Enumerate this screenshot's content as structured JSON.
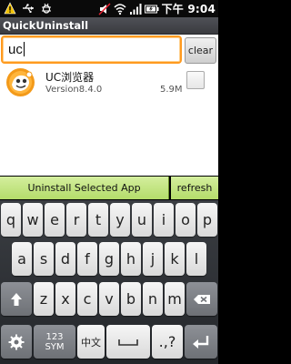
{
  "status_bar": {
    "time": "下午 9:04",
    "icons": [
      "warning-icon",
      "usb-icon",
      "usb-debug-icon",
      "mute-icon",
      "wifi-icon",
      "signal-icon",
      "battery-icon"
    ]
  },
  "app": {
    "title": "QuickUninstall"
  },
  "search": {
    "value": "uc",
    "clear_label": "clear"
  },
  "apps": [
    {
      "name": "UC浏览器",
      "version": "Version8.4.0",
      "size": "5.9M",
      "checked": false,
      "icon": "uc-browser-icon"
    }
  ],
  "actions": {
    "uninstall_label": "Uninstall Selected App",
    "refresh_label": "refresh"
  },
  "keyboard": {
    "row1": [
      "q",
      "w",
      "e",
      "r",
      "t",
      "y",
      "u",
      "i",
      "o",
      "p"
    ],
    "row2": [
      "a",
      "s",
      "d",
      "f",
      "g",
      "h",
      "j",
      "k",
      "l"
    ],
    "row3": [
      "z",
      "x",
      "c",
      "v",
      "b",
      "n",
      "m"
    ],
    "sym_label": "123\nSYM",
    "lang_label": "中文",
    "punct_label": ".,?",
    "icons": [
      "shift-icon",
      "backspace-icon",
      "settings-icon",
      "space-icon",
      "enter-icon"
    ]
  },
  "colors": {
    "accent": "#ff9a1f",
    "action_green": "#c2e482",
    "titlebar": "#45474c"
  }
}
